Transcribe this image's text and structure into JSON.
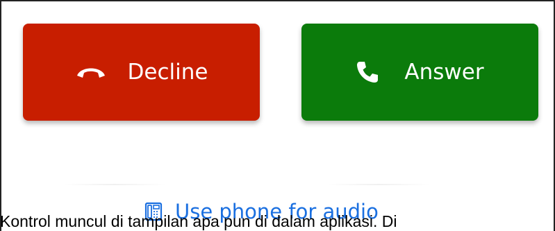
{
  "call_controls": {
    "decline": {
      "label": "Decline",
      "icon": "hang-up-icon",
      "color": "#c81e00"
    },
    "answer": {
      "label": "Answer",
      "icon": "phone-icon",
      "color": "#0b7b0b"
    }
  },
  "audio_option": {
    "label": "Use phone for audio",
    "icon": "desk-phone-icon",
    "color": "#1a6fe0"
  },
  "caption": {
    "text": "Kontrol muncul di tampilan apa pun di dalam aplikasi. Di"
  }
}
